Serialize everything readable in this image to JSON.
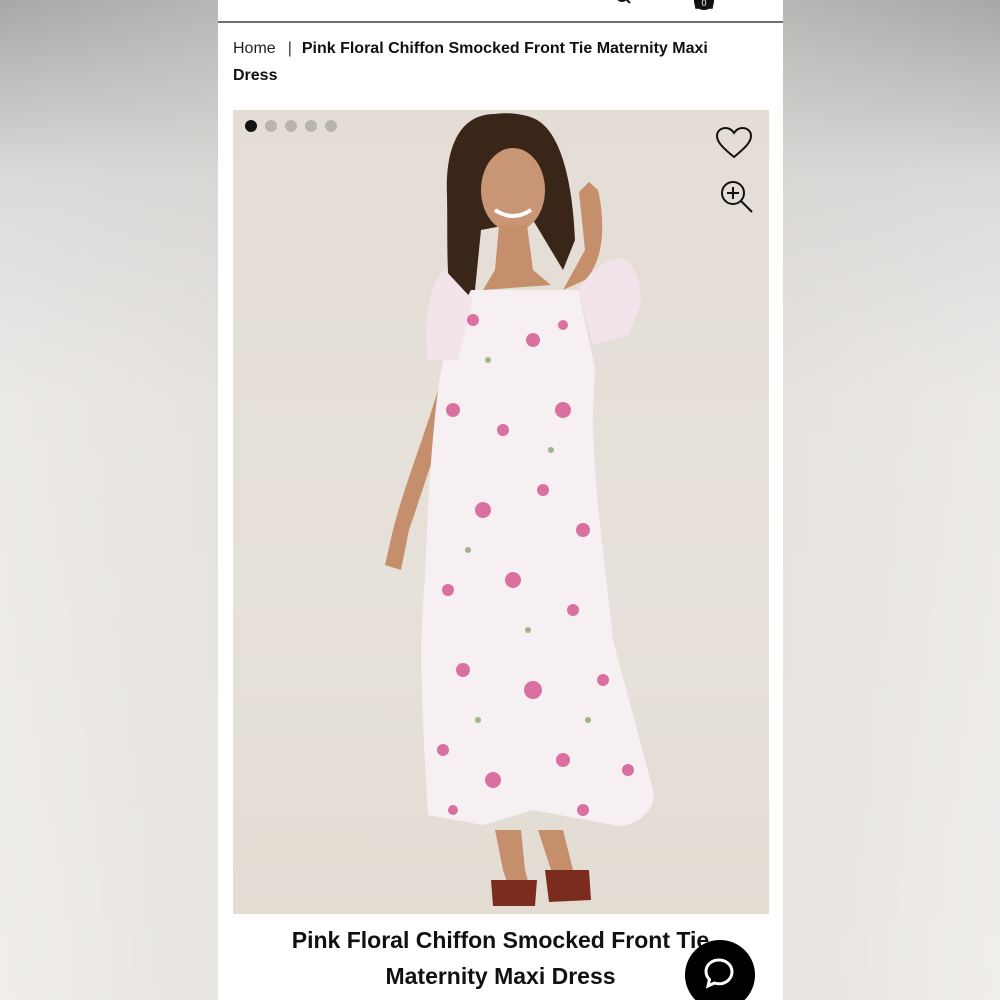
{
  "header": {
    "cart_count": "0"
  },
  "breadcrumb": {
    "home": "Home",
    "separator": "|",
    "current": "Pink Floral Chiffon Smocked Front Tie Maternity Maxi Dress"
  },
  "gallery": {
    "image_count": 5,
    "active_index": 0,
    "icons": [
      "heart-icon",
      "zoom-in-icon"
    ],
    "background_color": "#e4ded6"
  },
  "product": {
    "title": "Pink Floral Chiffon Smocked Front Tie Maternity Maxi Dress"
  },
  "chat": {
    "icon": "chat-bubble-icon"
  },
  "colors": {
    "text": "#111111",
    "dot_active": "#111111",
    "dot_inactive": "#b8b4ae",
    "chat_button": "#000000"
  }
}
